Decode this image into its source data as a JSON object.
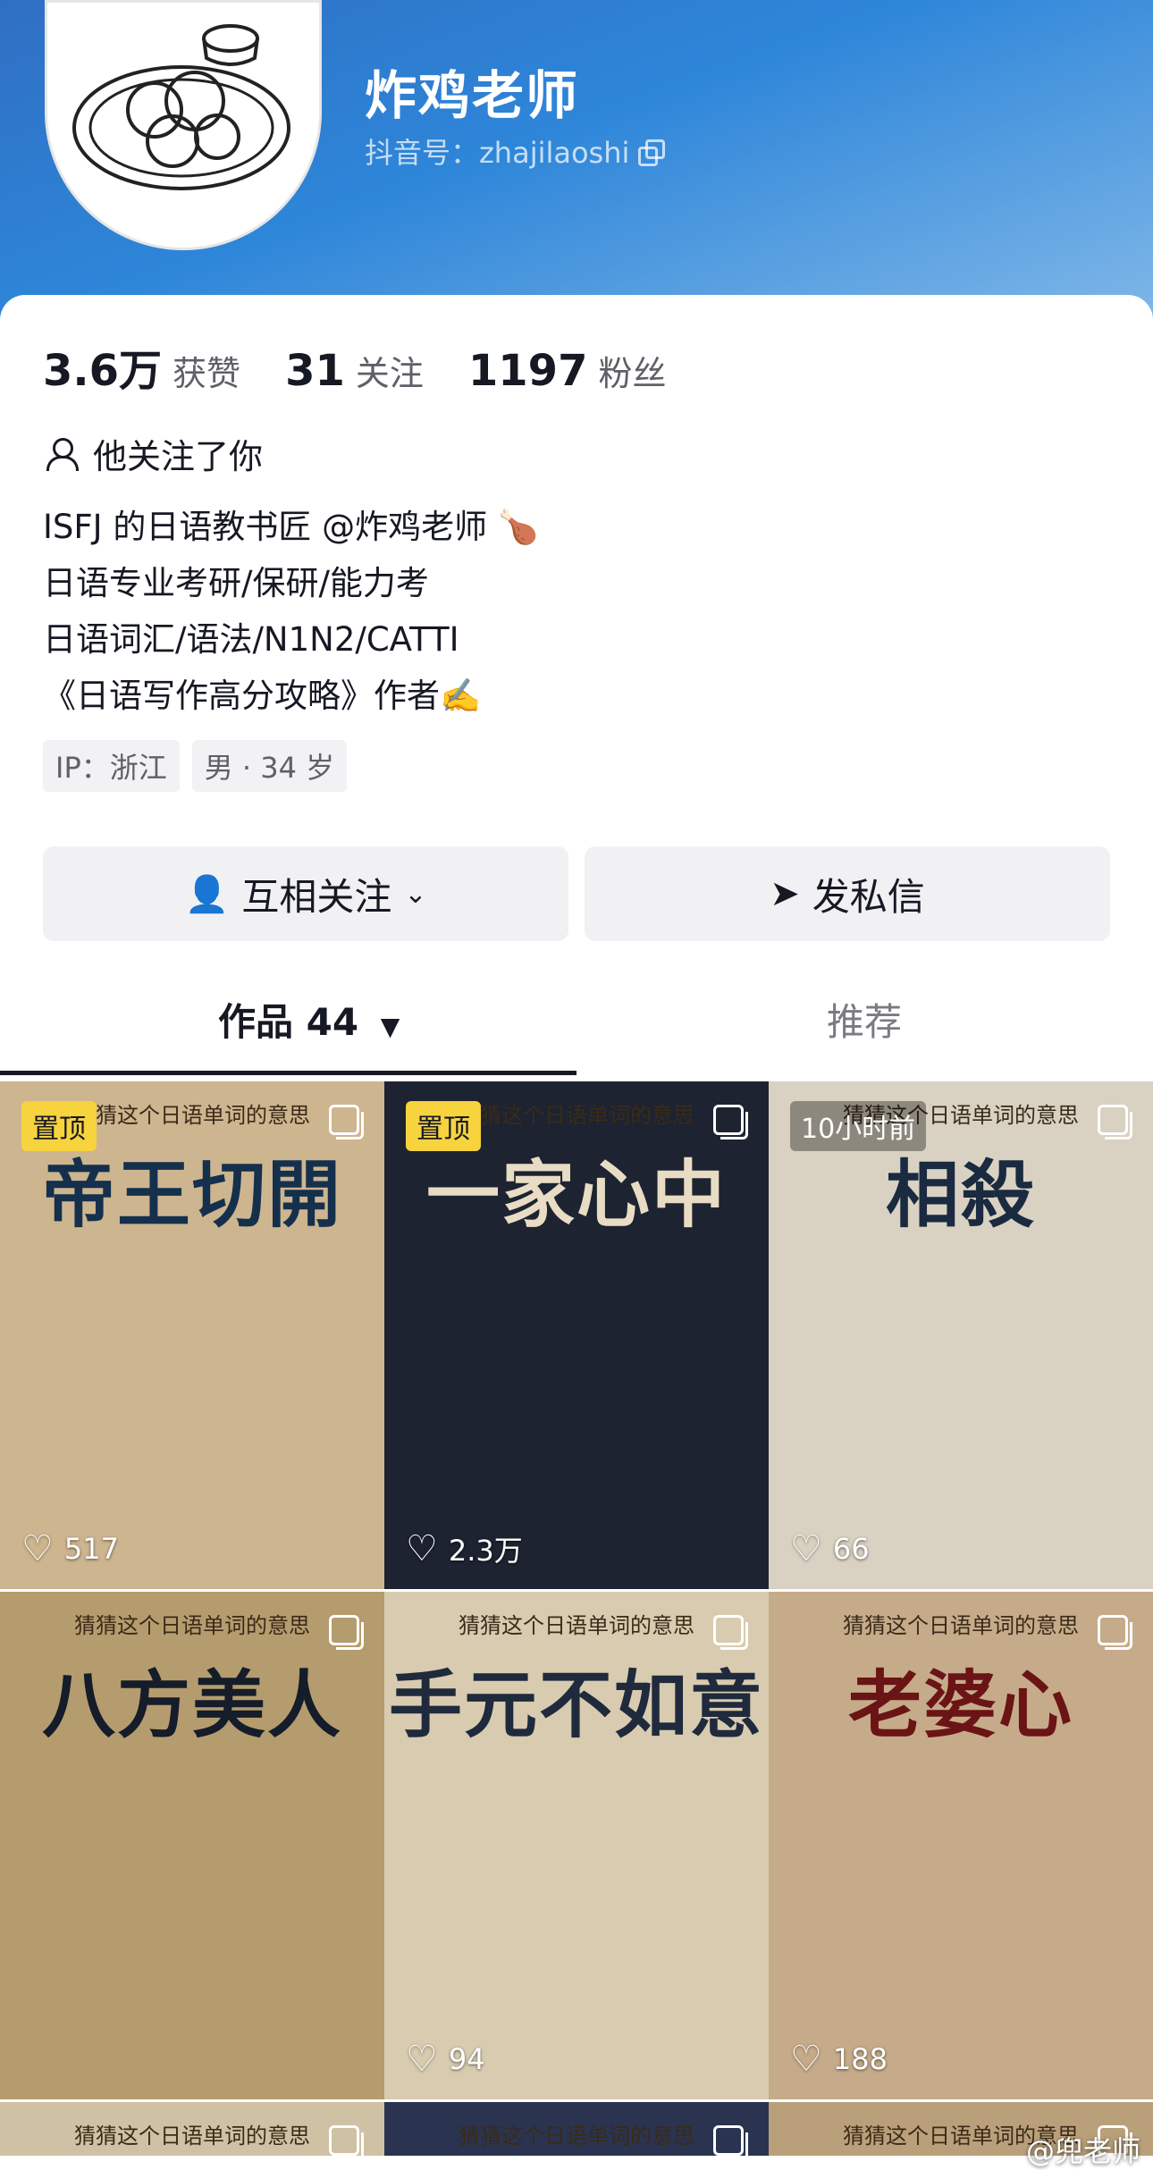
{
  "profile": {
    "name": "炸鸡老师",
    "douyin_id": "抖音号：zhajilaoshi"
  },
  "stats": [
    {
      "value": "3.6万",
      "label": "获赞"
    },
    {
      "value": "31",
      "label": "关注"
    },
    {
      "value": "1197",
      "label": "粉丝"
    }
  ],
  "follow_note": "他关注了你",
  "bio": [
    "ISFJ 的日语教书匠 @炸鸡老师 🍗",
    "日语专业考研/保研/能力考",
    "日语词汇/语法/N1N2/CATTI",
    "《日语写作高分攻略》作者✍️"
  ],
  "tags": [
    "IP：浙江",
    "男 · 34 岁"
  ],
  "buttons": {
    "follow": "互相关注",
    "message": "发私信"
  },
  "tabs": {
    "works": "作品 44",
    "recommend": "推荐"
  },
  "videos": [
    {
      "badge": "置顶",
      "badge_type": "pin",
      "top": "猜猜这个日语单词的意思",
      "title": "帝王切開",
      "likes": "517",
      "bg": "#cdb58f",
      "color": "#14304d"
    },
    {
      "badge": "置顶",
      "badge_type": "pin",
      "top": "猜猜这个日语单词的意思",
      "title": "一家心中",
      "likes": "2.3万",
      "bg": "#1d2330",
      "color": "#e8dcc4"
    },
    {
      "badge": "10小时前",
      "badge_type": "time",
      "top": "猜猜这个日语单词的意思",
      "title": "相殺",
      "likes": "66",
      "bg": "#d9d2c2",
      "color": "#1a2a40"
    },
    {
      "badge": "",
      "badge_type": "",
      "top": "猜猜这个日语单词的意思",
      "title": "八方美人",
      "likes": "",
      "bg": "#b59c6e",
      "color": "#151c2a"
    },
    {
      "badge": "",
      "badge_type": "",
      "top": "猜猜这个日语单词的意思",
      "title": "手元不如意",
      "likes": "94",
      "bg": "#d8cbb0",
      "color": "#1f2a3c"
    },
    {
      "badge": "",
      "badge_type": "",
      "top": "猜猜这个日语单词的意思",
      "title": "老婆心",
      "likes": "188",
      "bg": "#c6ab8a",
      "color": "#6a1416"
    },
    {
      "badge": "",
      "badge_type": "",
      "top": "猜猜这个日语单词的意思",
      "title": "",
      "likes": "",
      "bg": "#cfc1a4",
      "color": "#14304d"
    },
    {
      "badge": "",
      "badge_type": "",
      "top": "猜猜这个日语单词的意思",
      "title": "",
      "likes": "",
      "bg": "#2a3450",
      "color": "#e8dcc4"
    },
    {
      "badge": "",
      "badge_type": "",
      "top": "猜猜这个日语单词的意思",
      "title": "",
      "likes": "",
      "bg": "#b9a07a",
      "color": "#14304d"
    }
  ],
  "watermark": "@兜老师"
}
